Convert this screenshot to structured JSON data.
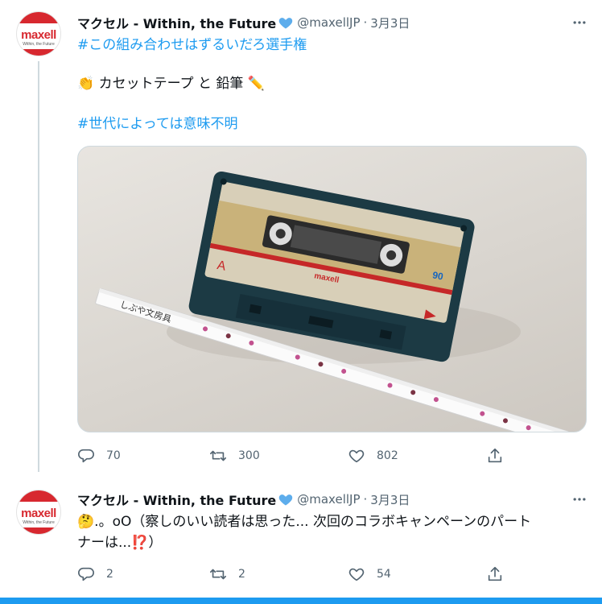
{
  "tweets": [
    {
      "author": {
        "name": "マクセル - Within, the Future",
        "handle": "@maxellJP",
        "date": "3月3日",
        "avatar": {
          "logo": "maxell",
          "tagline": "Within, the Future"
        }
      },
      "lines": [
        "#この組み合わせはずるいだろ選手権",
        "👏 カセットテープ と 鉛筆 ✏️",
        "#世代によっては意味不明"
      ],
      "photo": {
        "label": "maxell",
        "tape_length": "90",
        "side": "A",
        "pencil_text": "しぶや文房具"
      },
      "stats": {
        "replies": "70",
        "retweets": "300",
        "likes": "802"
      }
    },
    {
      "author": {
        "name": "マクセル - Within, the Future",
        "handle": "@maxellJP",
        "date": "3月3日",
        "avatar": {
          "logo": "maxell",
          "tagline": "Within, the Future"
        }
      },
      "lines": [
        "🤔.。oO（察しのいい読者は思った... 次回のコラボキャンペーンのパート",
        "ナーは...⁉️）"
      ],
      "stats": {
        "replies": "2",
        "retweets": "2",
        "likes": "54"
      }
    }
  ],
  "colors": {
    "accent": "#1d9bf0",
    "brand": "#d7282f",
    "muted": "#536471"
  }
}
